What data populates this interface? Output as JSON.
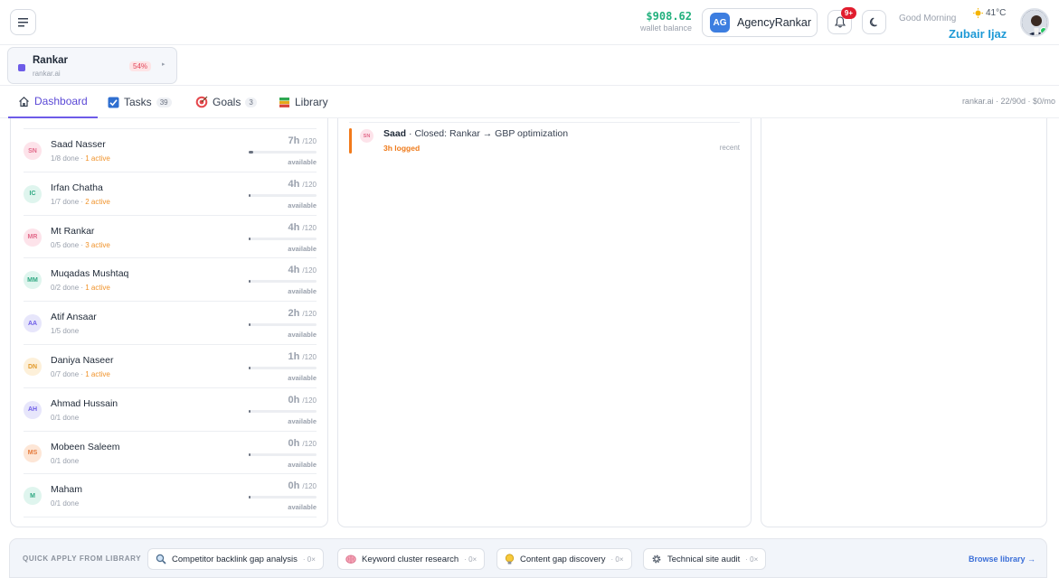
{
  "header": {
    "wallet_amount": "$908.62",
    "wallet_label": "wallet balance",
    "agency_initials": "AG",
    "agency_name": "AgencyRankar",
    "notif_badge": "9+",
    "greeting": "Good Morning",
    "weather": "41°C",
    "user_name": "Zubair Ijaz"
  },
  "project": {
    "name": "Rankar",
    "url": "rankar.ai",
    "progress": "54%",
    "color": "#6d5ce8"
  },
  "tabs": [
    {
      "label": "Dashboard",
      "icon": "home-icon"
    },
    {
      "label": "Tasks",
      "count": "39",
      "icon": "checkbox-icon"
    },
    {
      "label": "Goals",
      "count": "3",
      "icon": "target-icon"
    },
    {
      "label": "Library",
      "icon": "book-icon"
    }
  ],
  "tab_meta": "rankar.ai · 22/90d · $0/mo",
  "team": [
    {
      "initials": "SN",
      "name": "Saad Nasser",
      "done": "1/8 done",
      "active": "1 active",
      "hours": "7h",
      "of": "/120",
      "fraction": 0.06,
      "avatar_bg": "#fde3ea",
      "avatar_fg": "#e26b8b",
      "avail": "available"
    },
    {
      "initials": "IC",
      "name": "Irfan Chatha",
      "done": "1/7 done",
      "active": "2 active",
      "hours": "4h",
      "of": "/120",
      "fraction": 0.03,
      "avatar_bg": "#dff5ee",
      "avatar_fg": "#2fa882",
      "avail": "available"
    },
    {
      "initials": "MR",
      "name": "Mt Rankar",
      "done": "0/5 done",
      "active": "3 active",
      "hours": "4h",
      "of": "/120",
      "fraction": 0.03,
      "avatar_bg": "#fde3ea",
      "avatar_fg": "#e26b8b",
      "avail": "available"
    },
    {
      "initials": "MM",
      "name": "Muqadas Mushtaq",
      "done": "0/2 done",
      "active": "1 active",
      "hours": "4h",
      "of": "/120",
      "fraction": 0.03,
      "avatar_bg": "#dff5ee",
      "avatar_fg": "#2fa882",
      "avail": "available"
    },
    {
      "initials": "AA",
      "name": "Atif Ansaar",
      "done": "1/5 done",
      "active": "",
      "hours": "2h",
      "of": "/120",
      "fraction": 0.02,
      "avatar_bg": "#e7e6fb",
      "avatar_fg": "#6d5ce8",
      "avail": "available"
    },
    {
      "initials": "DN",
      "name": "Daniya Naseer",
      "done": "0/7 done",
      "active": "1 active",
      "hours": "1h",
      "of": "/120",
      "fraction": 0.01,
      "avatar_bg": "#fdf0d9",
      "avatar_fg": "#e29a2b",
      "avail": "available"
    },
    {
      "initials": "AH",
      "name": "Ahmad Hussain",
      "done": "0/1 done",
      "active": "",
      "hours": "0h",
      "of": "/120",
      "fraction": 0,
      "avatar_bg": "#e7e6fb",
      "avatar_fg": "#6d5ce8",
      "avail": "available"
    },
    {
      "initials": "MS",
      "name": "Mobeen Saleem",
      "done": "0/1 done",
      "active": "",
      "hours": "0h",
      "of": "/120",
      "fraction": 0,
      "avatar_bg": "#fde6d6",
      "avatar_fg": "#e5793a",
      "avail": "available"
    },
    {
      "initials": "M",
      "name": "Maham",
      "done": "0/1 done",
      "active": "",
      "hours": "0h",
      "of": "/120",
      "fraction": 0,
      "avatar_bg": "#dff5ee",
      "avatar_fg": "#2fa882",
      "avail": "available"
    }
  ],
  "activity": {
    "initials": "SN",
    "actor": "Saad",
    "text": "· Closed: Rankar → GBP optimization",
    "logged": "3h logged",
    "when": "recent"
  },
  "quick_apply": {
    "label": "QUICK APPLY FROM LIBRARY",
    "items": [
      {
        "label": "Competitor backlink gap analysis",
        "count": "· 0×",
        "icon": "magnifier-icon"
      },
      {
        "label": "Keyword cluster research",
        "count": "· 0×",
        "icon": "brain-icon"
      },
      {
        "label": "Content gap discovery",
        "count": "· 0×",
        "icon": "lightbulb-icon"
      },
      {
        "label": "Technical site audit",
        "count": "· 0×",
        "icon": "gear-icon"
      }
    ],
    "browse": "Browse library →"
  }
}
